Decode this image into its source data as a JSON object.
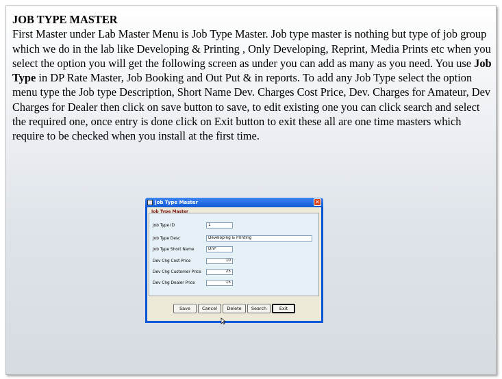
{
  "heading": "JOB TYPE MASTER",
  "paragraph": {
    "part1": "First Master under Lab Master Menu is Job Type Master. Job type master is nothing but type of job group which we do in the lab like  Developing & Printing , Only Developing, Reprint, Media Prints etc when you select the option you will get the following screen as under you can add as many as you need. You use ",
    "bold": "Job Type",
    "part2": " in DP Rate Master, Job Booking and Out Put & in reports. To add any Job Type select the option menu type the Job type Description, Short Name Dev. Charges Cost Price, Dev. Charges for Amateur, Dev Charges for Dealer   then click on save button to save, to edit existing one you can click search and select the required one, once entry is done click on Exit button to exit these all are one time masters which require to be checked when you install at the first time."
  },
  "dialog": {
    "title": "Job Type Master",
    "close": "✕",
    "group_title": "Job Type Master",
    "fields": {
      "id": {
        "label": "Job Type ID",
        "value": "1"
      },
      "desc": {
        "label": "Job Type Desc",
        "value": "Developing & Printing"
      },
      "short": {
        "label": "Job Type Short Name",
        "value": "DnP"
      },
      "cost": {
        "label": "Dev Chg Cost Price",
        "value": "10"
      },
      "customer": {
        "label": "Dev Chg Customer Price",
        "value": "25"
      },
      "dealer": {
        "label": "Dev Chg Dealer Price",
        "value": "15"
      }
    },
    "buttons": {
      "save": "Save",
      "cancel": "Cancel",
      "delete": "Delete",
      "search": "Search",
      "exit": "Exit"
    }
  },
  "colors": {
    "titlebar": "#0a56d8",
    "group_title": "#7a1b1b",
    "close": "#d9431f"
  }
}
